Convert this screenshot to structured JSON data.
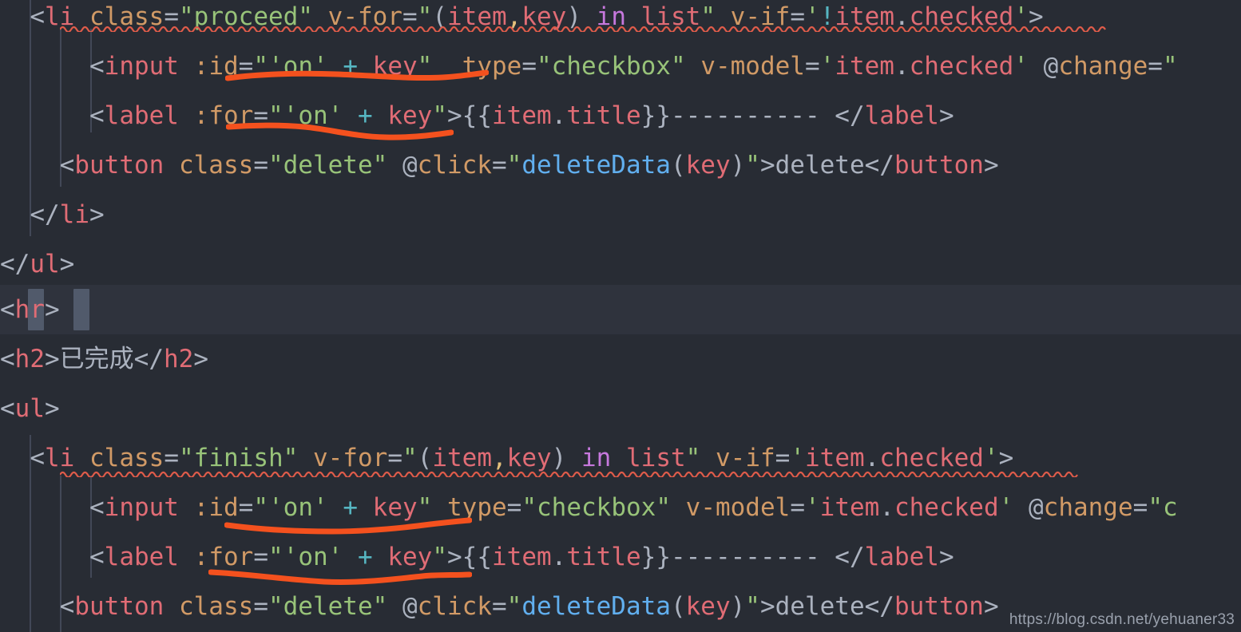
{
  "editor": {
    "theme_name": "one-dark",
    "background_color": "#282c34",
    "current_line_color": "#2f333d",
    "indent_guide_color": "#4b5263",
    "bracket_match_color": "#515a6b",
    "squiggle_color": "#e05c4a",
    "annotation_color": "#f4511e",
    "font_size_px": 31,
    "line_height_px": 62
  },
  "palette": {
    "punctuation": "#abb2bf",
    "tag": "#e06c75",
    "attribute": "#d19a66",
    "string": "#98c379",
    "variable": "#e06c75",
    "keyword": "#c678dd",
    "operator": "#56b6c2",
    "comma": "#e5c07b",
    "function": "#61afef",
    "text": "#abb2bf"
  },
  "watermark": {
    "text": "https://blog.csdn.net/yehuaner33"
  },
  "lines": [
    {
      "id": "line-li-proceed",
      "plain": "  <li class=\"proceed\" v-for=\"(item,key) in list\" v-if='!item.checked'>",
      "tokens": [
        {
          "text": "  ",
          "cls": "t-punct"
        },
        {
          "text": "<",
          "cls": "t-punct"
        },
        {
          "text": "li",
          "cls": "t-tag"
        },
        {
          "text": " ",
          "cls": "t-punct"
        },
        {
          "text": "class",
          "cls": "t-attr"
        },
        {
          "text": "=",
          "cls": "t-punct"
        },
        {
          "text": "\"proceed\"",
          "cls": "t-str"
        },
        {
          "text": " ",
          "cls": "t-punct"
        },
        {
          "text": "v-for",
          "cls": "t-attr"
        },
        {
          "text": "=",
          "cls": "t-punct"
        },
        {
          "text": "\"",
          "cls": "t-str"
        },
        {
          "text": "(",
          "cls": "t-punct"
        },
        {
          "text": "item",
          "cls": "t-var"
        },
        {
          "text": ",",
          "cls": "t-comma"
        },
        {
          "text": "key",
          "cls": "t-var"
        },
        {
          "text": ")",
          "cls": "t-punct"
        },
        {
          "text": " ",
          "cls": "t-punct"
        },
        {
          "text": "in",
          "cls": "t-kw"
        },
        {
          "text": " ",
          "cls": "t-punct"
        },
        {
          "text": "list",
          "cls": "t-var"
        },
        {
          "text": "\"",
          "cls": "t-str"
        },
        {
          "text": " ",
          "cls": "t-punct"
        },
        {
          "text": "v-if",
          "cls": "t-attr"
        },
        {
          "text": "=",
          "cls": "t-punct"
        },
        {
          "text": "'",
          "cls": "t-str"
        },
        {
          "text": "!",
          "cls": "t-op"
        },
        {
          "text": "item",
          "cls": "t-var"
        },
        {
          "text": ".",
          "cls": "t-punct"
        },
        {
          "text": "checked",
          "cls": "t-var"
        },
        {
          "text": "'",
          "cls": "t-str"
        },
        {
          "text": ">",
          "cls": "t-punct"
        }
      ]
    },
    {
      "id": "line-input-proceed",
      "plain": "      <input :id=\"'on' + key\"  type=\"checkbox\" v-model='item.checked' @change=\"",
      "tokens": [
        {
          "text": "      ",
          "cls": "t-punct"
        },
        {
          "text": "<",
          "cls": "t-punct"
        },
        {
          "text": "input",
          "cls": "t-tag"
        },
        {
          "text": " ",
          "cls": "t-punct"
        },
        {
          "text": ":id",
          "cls": "t-attr"
        },
        {
          "text": "=",
          "cls": "t-punct"
        },
        {
          "text": "\"",
          "cls": "t-str"
        },
        {
          "text": "'on'",
          "cls": "t-str"
        },
        {
          "text": " ",
          "cls": "t-punct"
        },
        {
          "text": "+",
          "cls": "t-op"
        },
        {
          "text": " ",
          "cls": "t-punct"
        },
        {
          "text": "key",
          "cls": "t-var"
        },
        {
          "text": "\"",
          "cls": "t-str"
        },
        {
          "text": "  ",
          "cls": "t-punct"
        },
        {
          "text": "type",
          "cls": "t-attr"
        },
        {
          "text": "=",
          "cls": "t-punct"
        },
        {
          "text": "\"checkbox\"",
          "cls": "t-str"
        },
        {
          "text": " ",
          "cls": "t-punct"
        },
        {
          "text": "v-model",
          "cls": "t-attr"
        },
        {
          "text": "=",
          "cls": "t-punct"
        },
        {
          "text": "'",
          "cls": "t-str"
        },
        {
          "text": "item",
          "cls": "t-var"
        },
        {
          "text": ".",
          "cls": "t-punct"
        },
        {
          "text": "checked",
          "cls": "t-var"
        },
        {
          "text": "'",
          "cls": "t-str"
        },
        {
          "text": " ",
          "cls": "t-punct"
        },
        {
          "text": "@",
          "cls": "t-punct"
        },
        {
          "text": "change",
          "cls": "t-attr"
        },
        {
          "text": "=",
          "cls": "t-punct"
        },
        {
          "text": "\"",
          "cls": "t-str"
        }
      ]
    },
    {
      "id": "line-label-proceed",
      "plain": "      <label :for=\"'on' + key\">{{item.title}}—————————— </label>",
      "tokens": [
        {
          "text": "      ",
          "cls": "t-punct"
        },
        {
          "text": "<",
          "cls": "t-punct"
        },
        {
          "text": "label",
          "cls": "t-tag"
        },
        {
          "text": " ",
          "cls": "t-punct"
        },
        {
          "text": ":for",
          "cls": "t-attr"
        },
        {
          "text": "=",
          "cls": "t-punct"
        },
        {
          "text": "\"",
          "cls": "t-str"
        },
        {
          "text": "'on'",
          "cls": "t-str"
        },
        {
          "text": " ",
          "cls": "t-punct"
        },
        {
          "text": "+",
          "cls": "t-op"
        },
        {
          "text": " ",
          "cls": "t-punct"
        },
        {
          "text": "key",
          "cls": "t-var"
        },
        {
          "text": "\"",
          "cls": "t-str"
        },
        {
          "text": ">",
          "cls": "t-punct"
        },
        {
          "text": "{{",
          "cls": "t-punct"
        },
        {
          "text": "item",
          "cls": "t-var"
        },
        {
          "text": ".",
          "cls": "t-punct"
        },
        {
          "text": "title",
          "cls": "t-var"
        },
        {
          "text": "}}",
          "cls": "t-punct"
        },
        {
          "text": "----------",
          "cls": "t-text"
        },
        {
          "text": " ",
          "cls": "t-punct"
        },
        {
          "text": "</",
          "cls": "t-punct"
        },
        {
          "text": "label",
          "cls": "t-tag"
        },
        {
          "text": ">",
          "cls": "t-punct"
        }
      ]
    },
    {
      "id": "line-button-proceed",
      "plain": "    <button class=\"delete\" @click=\"deleteData(key)\">delete</button>",
      "tokens": [
        {
          "text": "    ",
          "cls": "t-punct"
        },
        {
          "text": "<",
          "cls": "t-punct"
        },
        {
          "text": "button",
          "cls": "t-tag"
        },
        {
          "text": " ",
          "cls": "t-punct"
        },
        {
          "text": "class",
          "cls": "t-attr"
        },
        {
          "text": "=",
          "cls": "t-punct"
        },
        {
          "text": "\"delete\"",
          "cls": "t-str"
        },
        {
          "text": " ",
          "cls": "t-punct"
        },
        {
          "text": "@",
          "cls": "t-punct"
        },
        {
          "text": "click",
          "cls": "t-attr"
        },
        {
          "text": "=",
          "cls": "t-punct"
        },
        {
          "text": "\"",
          "cls": "t-str"
        },
        {
          "text": "deleteData",
          "cls": "t-fn"
        },
        {
          "text": "(",
          "cls": "t-punct"
        },
        {
          "text": "key",
          "cls": "t-var"
        },
        {
          "text": ")",
          "cls": "t-punct"
        },
        {
          "text": "\"",
          "cls": "t-str"
        },
        {
          "text": ">",
          "cls": "t-punct"
        },
        {
          "text": "delete",
          "cls": "t-text"
        },
        {
          "text": "</",
          "cls": "t-punct"
        },
        {
          "text": "button",
          "cls": "t-tag"
        },
        {
          "text": ">",
          "cls": "t-punct"
        }
      ]
    },
    {
      "id": "line-close-li-1",
      "plain": "  </li>",
      "tokens": [
        {
          "text": "  ",
          "cls": "t-punct"
        },
        {
          "text": "</",
          "cls": "t-punct"
        },
        {
          "text": "li",
          "cls": "t-tag"
        },
        {
          "text": ">",
          "cls": "t-punct"
        }
      ]
    },
    {
      "id": "line-close-ul-1",
      "plain": "</ul>",
      "tokens": [
        {
          "text": "</",
          "cls": "t-punct"
        },
        {
          "text": "ul",
          "cls": "t-tag"
        },
        {
          "text": ">",
          "cls": "t-punct"
        }
      ]
    },
    {
      "id": "line-hr",
      "plain": "<hr>",
      "current": true,
      "tokens": [
        {
          "text": "<",
          "cls": "t-punct"
        },
        {
          "text": "hr",
          "cls": "t-tag"
        },
        {
          "text": ">",
          "cls": "t-punct"
        }
      ]
    },
    {
      "id": "line-h2-finished",
      "plain": "<h2>已完成</h2>",
      "tokens": [
        {
          "text": "<",
          "cls": "t-punct"
        },
        {
          "text": "h2",
          "cls": "t-tag"
        },
        {
          "text": ">",
          "cls": "t-punct"
        },
        {
          "text": "已完成",
          "cls": "t-han"
        },
        {
          "text": "</",
          "cls": "t-punct"
        },
        {
          "text": "h2",
          "cls": "t-tag"
        },
        {
          "text": ">",
          "cls": "t-punct"
        }
      ]
    },
    {
      "id": "line-open-ul-2",
      "plain": "<ul>",
      "tokens": [
        {
          "text": "<",
          "cls": "t-punct"
        },
        {
          "text": "ul",
          "cls": "t-tag"
        },
        {
          "text": ">",
          "cls": "t-punct"
        }
      ]
    },
    {
      "id": "line-li-finish",
      "plain": "  <li class=\"finish\" v-for=\"(item,key) in list\" v-if='item.checked'>",
      "tokens": [
        {
          "text": "  ",
          "cls": "t-punct"
        },
        {
          "text": "<",
          "cls": "t-punct"
        },
        {
          "text": "li",
          "cls": "t-tag"
        },
        {
          "text": " ",
          "cls": "t-punct"
        },
        {
          "text": "class",
          "cls": "t-attr"
        },
        {
          "text": "=",
          "cls": "t-punct"
        },
        {
          "text": "\"finish\"",
          "cls": "t-str"
        },
        {
          "text": " ",
          "cls": "t-punct"
        },
        {
          "text": "v-for",
          "cls": "t-attr"
        },
        {
          "text": "=",
          "cls": "t-punct"
        },
        {
          "text": "\"",
          "cls": "t-str"
        },
        {
          "text": "(",
          "cls": "t-punct"
        },
        {
          "text": "item",
          "cls": "t-var"
        },
        {
          "text": ",",
          "cls": "t-comma"
        },
        {
          "text": "key",
          "cls": "t-var"
        },
        {
          "text": ")",
          "cls": "t-punct"
        },
        {
          "text": " ",
          "cls": "t-punct"
        },
        {
          "text": "in",
          "cls": "t-kw"
        },
        {
          "text": " ",
          "cls": "t-punct"
        },
        {
          "text": "list",
          "cls": "t-var"
        },
        {
          "text": "\"",
          "cls": "t-str"
        },
        {
          "text": " ",
          "cls": "t-punct"
        },
        {
          "text": "v-if",
          "cls": "t-attr"
        },
        {
          "text": "=",
          "cls": "t-punct"
        },
        {
          "text": "'",
          "cls": "t-str"
        },
        {
          "text": "item",
          "cls": "t-var"
        },
        {
          "text": ".",
          "cls": "t-punct"
        },
        {
          "text": "checked",
          "cls": "t-var"
        },
        {
          "text": "'",
          "cls": "t-str"
        },
        {
          "text": ">",
          "cls": "t-punct"
        }
      ]
    },
    {
      "id": "line-input-finish",
      "plain": "      <input :id=\"'on' + key\" type=\"checkbox\" v-model='item.checked' @change=\"c",
      "tokens": [
        {
          "text": "      ",
          "cls": "t-punct"
        },
        {
          "text": "<",
          "cls": "t-punct"
        },
        {
          "text": "input",
          "cls": "t-tag"
        },
        {
          "text": " ",
          "cls": "t-punct"
        },
        {
          "text": ":id",
          "cls": "t-attr"
        },
        {
          "text": "=",
          "cls": "t-punct"
        },
        {
          "text": "\"",
          "cls": "t-str"
        },
        {
          "text": "'on'",
          "cls": "t-str"
        },
        {
          "text": " ",
          "cls": "t-punct"
        },
        {
          "text": "+",
          "cls": "t-op"
        },
        {
          "text": " ",
          "cls": "t-punct"
        },
        {
          "text": "key",
          "cls": "t-var"
        },
        {
          "text": "\"",
          "cls": "t-str"
        },
        {
          "text": " ",
          "cls": "t-punct"
        },
        {
          "text": "type",
          "cls": "t-attr"
        },
        {
          "text": "=",
          "cls": "t-punct"
        },
        {
          "text": "\"checkbox\"",
          "cls": "t-str"
        },
        {
          "text": " ",
          "cls": "t-punct"
        },
        {
          "text": "v-model",
          "cls": "t-attr"
        },
        {
          "text": "=",
          "cls": "t-punct"
        },
        {
          "text": "'",
          "cls": "t-str"
        },
        {
          "text": "item",
          "cls": "t-var"
        },
        {
          "text": ".",
          "cls": "t-punct"
        },
        {
          "text": "checked",
          "cls": "t-var"
        },
        {
          "text": "'",
          "cls": "t-str"
        },
        {
          "text": " ",
          "cls": "t-punct"
        },
        {
          "text": "@",
          "cls": "t-punct"
        },
        {
          "text": "change",
          "cls": "t-attr"
        },
        {
          "text": "=",
          "cls": "t-punct"
        },
        {
          "text": "\"c",
          "cls": "t-str"
        }
      ]
    },
    {
      "id": "line-label-finish",
      "plain": "      <label :for=\"'on' + key\">{{item.title}}—————————— </label>",
      "tokens": [
        {
          "text": "      ",
          "cls": "t-punct"
        },
        {
          "text": "<",
          "cls": "t-punct"
        },
        {
          "text": "label",
          "cls": "t-tag"
        },
        {
          "text": " ",
          "cls": "t-punct"
        },
        {
          "text": ":for",
          "cls": "t-attr"
        },
        {
          "text": "=",
          "cls": "t-punct"
        },
        {
          "text": "\"",
          "cls": "t-str"
        },
        {
          "text": "'on'",
          "cls": "t-str"
        },
        {
          "text": " ",
          "cls": "t-punct"
        },
        {
          "text": "+",
          "cls": "t-op"
        },
        {
          "text": " ",
          "cls": "t-punct"
        },
        {
          "text": "key",
          "cls": "t-var"
        },
        {
          "text": "\"",
          "cls": "t-str"
        },
        {
          "text": ">",
          "cls": "t-punct"
        },
        {
          "text": "{{",
          "cls": "t-punct"
        },
        {
          "text": "item",
          "cls": "t-var"
        },
        {
          "text": ".",
          "cls": "t-punct"
        },
        {
          "text": "title",
          "cls": "t-var"
        },
        {
          "text": "}}",
          "cls": "t-punct"
        },
        {
          "text": "----------",
          "cls": "t-text"
        },
        {
          "text": " ",
          "cls": "t-punct"
        },
        {
          "text": "</",
          "cls": "t-punct"
        },
        {
          "text": "label",
          "cls": "t-tag"
        },
        {
          "text": ">",
          "cls": "t-punct"
        }
      ]
    },
    {
      "id": "line-button-finish",
      "plain": "    <button class=\"delete\" @click=\"deleteData(key)\">delete</button>",
      "tokens": [
        {
          "text": "    ",
          "cls": "t-punct"
        },
        {
          "text": "<",
          "cls": "t-punct"
        },
        {
          "text": "button",
          "cls": "t-tag"
        },
        {
          "text": " ",
          "cls": "t-punct"
        },
        {
          "text": "class",
          "cls": "t-attr"
        },
        {
          "text": "=",
          "cls": "t-punct"
        },
        {
          "text": "\"delete\"",
          "cls": "t-str"
        },
        {
          "text": " ",
          "cls": "t-punct"
        },
        {
          "text": "@",
          "cls": "t-punct"
        },
        {
          "text": "click",
          "cls": "t-attr"
        },
        {
          "text": "=",
          "cls": "t-punct"
        },
        {
          "text": "\"",
          "cls": "t-str"
        },
        {
          "text": "deleteData",
          "cls": "t-fn"
        },
        {
          "text": "(",
          "cls": "t-punct"
        },
        {
          "text": "key",
          "cls": "t-var"
        },
        {
          "text": ")",
          "cls": "t-punct"
        },
        {
          "text": "\"",
          "cls": "t-str"
        },
        {
          "text": ">",
          "cls": "t-punct"
        },
        {
          "text": "delete",
          "cls": "t-text"
        },
        {
          "text": "</",
          "cls": "t-punct"
        },
        {
          "text": "button",
          "cls": "t-tag"
        },
        {
          "text": ">",
          "cls": "t-punct"
        }
      ]
    }
  ]
}
